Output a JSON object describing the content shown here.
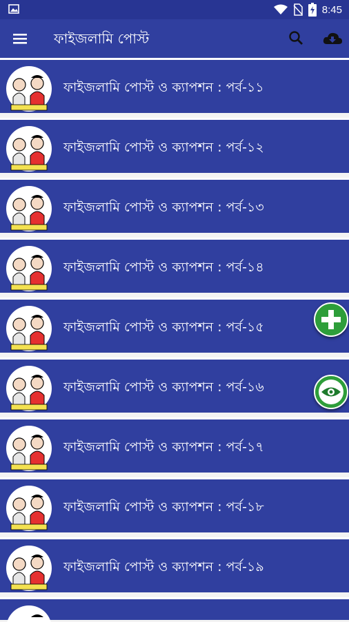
{
  "status_bar": {
    "time": "8:45",
    "icons": [
      "image-notification-icon",
      "wifi-icon",
      "no-sim-icon",
      "battery-charging-icon"
    ]
  },
  "toolbar": {
    "title": "ফাইজলামি পোস্ট",
    "icons": [
      "menu-icon",
      "search-icon",
      "cloud-download-icon"
    ]
  },
  "list": {
    "items": [
      {
        "label": "ফাইজলামি পোস্ট ও ক্যাপশন : পর্ব-১১"
      },
      {
        "label": "ফাইজলামি পোস্ট ও ক্যাপশন : পর্ব-১২"
      },
      {
        "label": "ফাইজলামি পোস্ট ও ক্যাপশন : পর্ব-১৩"
      },
      {
        "label": "ফাইজলামি পোস্ট ও ক্যাপশন : পর্ব-১৪"
      },
      {
        "label": "ফাইজলামি পোস্ট ও ক্যাপশন : পর্ব-১৫"
      },
      {
        "label": "ফাইজলামি পোস্ট ও ক্যাপশন : পর্ব-১৬"
      },
      {
        "label": "ফাইজলামি পোস্ট ও ক্যাপশন : পর্ব-১৭"
      },
      {
        "label": "ফাইজলামি পোস্ট ও ক্যাপশন : পর্ব-১৮"
      },
      {
        "label": "ফাইজলামি পোস্ট ও ক্যাপশন : পর্ব-১৯"
      },
      {
        "label": ""
      }
    ],
    "thumbnail_icon": "cartoon-thumbnail-icon"
  },
  "fabs": {
    "add_icon": "plus-icon",
    "view_icon": "eye-icon"
  },
  "colors": {
    "status_bar": "#283593",
    "toolbar": "#303f9f",
    "row": "#303f9f",
    "fab": "#2e9e3a"
  }
}
